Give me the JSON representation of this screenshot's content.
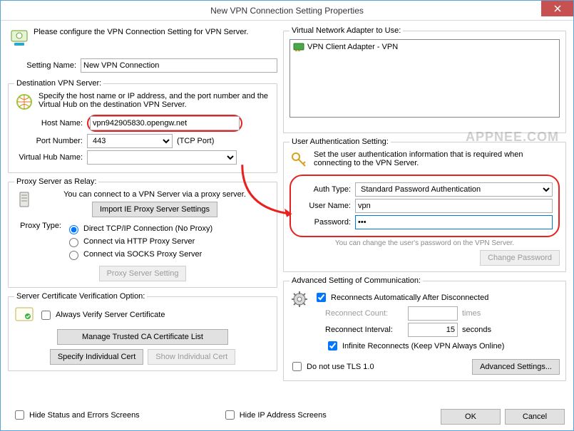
{
  "window": {
    "title": "New VPN Connection Setting Properties"
  },
  "top": {
    "instr": "Please configure the VPN Connection Setting for VPN Server."
  },
  "setting_name": {
    "label": "Setting Name:",
    "value": "New VPN Connection"
  },
  "dest": {
    "legend": "Destination VPN Server:",
    "desc": "Specify the host name or IP address, and the port number and the Virtual Hub on the destination VPN Server.",
    "host_label": "Host Name:",
    "host_value": "vpn942905830.opengw.net",
    "port_label": "Port Number:",
    "port_value": "443",
    "tcp_port": "(TCP Port)",
    "vhub_label": "Virtual Hub Name:",
    "vhub_value": ""
  },
  "proxy": {
    "legend": "Proxy Server as Relay:",
    "desc": "You can connect to a VPN Server via a proxy server.",
    "import_btn": "Import IE Proxy Server Settings",
    "type_label": "Proxy Type:",
    "opt_direct": "Direct TCP/IP Connection (No Proxy)",
    "opt_http": "Connect via HTTP Proxy Server",
    "opt_socks": "Connect via SOCKS Proxy Server",
    "setting_btn": "Proxy Server Setting"
  },
  "cert": {
    "legend": "Server Certificate Verification Option:",
    "always": "Always Verify Server Certificate",
    "manage_btn": "Manage Trusted CA Certificate List",
    "spec_btn": "Specify Individual Cert",
    "show_btn": "Show Individual Cert"
  },
  "bottom_left": {
    "hide_status": "Hide Status and Errors Screens",
    "hide_ip": "Hide IP Address Screens"
  },
  "adapter": {
    "legend": "Virtual Network Adapter to Use:",
    "item": "VPN Client Adapter - VPN"
  },
  "auth": {
    "legend": "User Authentication Setting:",
    "desc": "Set the user authentication information that is required when connecting to the VPN Server.",
    "type_label": "Auth Type:",
    "type_value": "Standard Password Authentication",
    "user_label": "User Name:",
    "user_value": "vpn",
    "pass_label": "Password:",
    "pass_value": "•••",
    "hint": "You can change the user's password on the VPN Server.",
    "change_btn": "Change Password"
  },
  "adv": {
    "legend": "Advanced Setting of Communication:",
    "reconnect_auto": "Reconnects Automatically After Disconnected",
    "count_label": "Reconnect Count:",
    "count_unit": "times",
    "interval_label": "Reconnect Interval:",
    "interval_value": "15",
    "interval_unit": "seconds",
    "infinite": "Infinite Reconnects (Keep VPN Always Online)",
    "no_tls": "Do not use TLS 1.0",
    "adv_btn": "Advanced Settings..."
  },
  "buttons": {
    "ok": "OK",
    "cancel": "Cancel"
  },
  "watermark": "APPNEE.COM"
}
